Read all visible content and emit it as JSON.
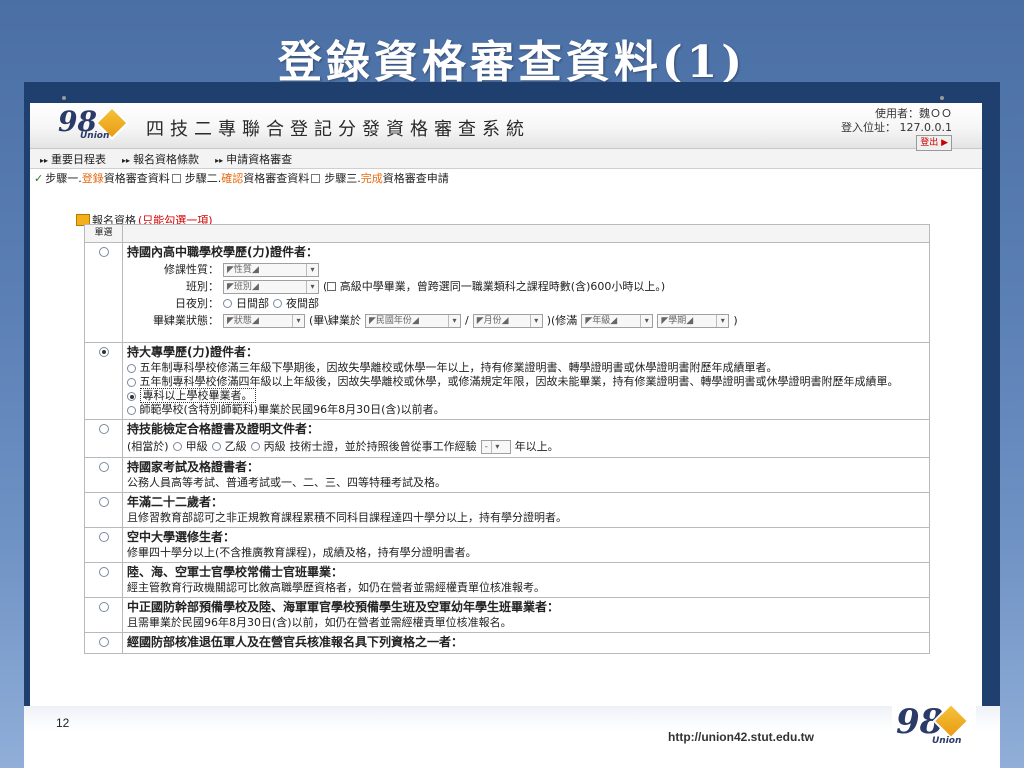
{
  "slide": {
    "title": "登錄資格審查資料(1)",
    "page_number": "12",
    "url": "http://union42.stut.edu.tw",
    "logo_text": "98",
    "logo_sub": "Union"
  },
  "app": {
    "title": "四技二專聯合登記分發資格審查系統",
    "user_label": "使用者：魏ＯＯ",
    "ip_label": "登入位址：",
    "ip_value": "127.0.0.1",
    "logout": "登出"
  },
  "nav": {
    "items": [
      "重要日程表",
      "報名資格條款",
      "申請資格審查"
    ]
  },
  "steps": {
    "s1_prefix": "步驟一.",
    "s1_hl": "登錄",
    "s1_suffix": "資格審查資料",
    "s2_prefix": "步驟二.",
    "s2_hl": "確認",
    "s2_suffix": "資格審查資料",
    "s3_prefix": "步驟三.",
    "s3_hl": "完成",
    "s3_suffix": "資格審查申請"
  },
  "section": {
    "label": "報名資格",
    "note": "(只能勾選一項)",
    "col_header": "單選"
  },
  "item1": {
    "title": "持國內高中職學校學歷(力)證件者：",
    "f1_label": "修課性質：",
    "f1_value": "性質",
    "f2_label": "班別：",
    "f2_value": "班別",
    "f2_note": "高級中學畢業，曾跨選同一職業類科之課程時數(含)600小時以上。)",
    "f3_label": "日夜別：",
    "f3_opt1": "日間部",
    "f3_opt2": "夜間部",
    "f4_label": "畢肄業狀態：",
    "f4_value": "狀態",
    "f4_text1": "(畢\\肄業於",
    "f4_year": "民國年份",
    "f4_month": "月份",
    "f4_text2": ")(修滿",
    "f4_grade": "年級",
    "f4_term": "學期"
  },
  "item2": {
    "title": "持大專學歷(力)證件者：",
    "opt1": "五年制專科學校修滿三年級下學期後，因故失學離校或休學一年以上，持有修業證明書、轉學證明書或休學證明書附歷年成績單者。",
    "opt2": "五年制專科學校修滿四年級以上年級後，因故失學離校或休學，或修滿規定年限，因故未能畢業，持有修業證明書、轉學證明書或休學證明書附歷年成績單。",
    "opt3": "專科以上學校畢業者。",
    "opt4": "師範學校(含特別師範科)畢業於民國96年8月30日(含)以前者。"
  },
  "item3": {
    "title": "持技能檢定合格證書及證明文件者：",
    "text1": "(相當於)",
    "g1": "甲級",
    "g2": "乙級",
    "g3": "丙級",
    "text2": "技術士證，並於持照後曾從事工作經驗",
    "dd": "-",
    "text3": "年以上。"
  },
  "item4": {
    "title": "持國家考試及格證書者：",
    "desc": "公務人員高等考試、普通考試或一、二、三、四等特種考試及格。"
  },
  "item5": {
    "title": "年滿二十二歲者：",
    "desc": "且修習教育部認可之非正規教育課程累積不同科目課程達四十學分以上，持有學分證明者。"
  },
  "item6": {
    "title": "空中大學選修生者：",
    "desc": "修畢四十學分以上(不含推廣教育課程)，成績及格，持有學分證明書者。"
  },
  "item7": {
    "title": "陸、海、空軍士官學校常備士官班畢業：",
    "desc": "經主管教育行政機關認可比敘高職學歷資格者，如仍在營者並需經權責單位核准報考。"
  },
  "item8": {
    "title": "中正國防幹部預備學校及陸、海軍軍官學校預備學生班及空軍幼年學生班畢業者：",
    "desc": "且需畢業於民國96年8月30日(含)以前，如仍在營者並需經權責單位核准報名。"
  },
  "item9": {
    "title": "經國防部核准退伍軍人及在營官兵核准報名具下列資格之一者："
  }
}
